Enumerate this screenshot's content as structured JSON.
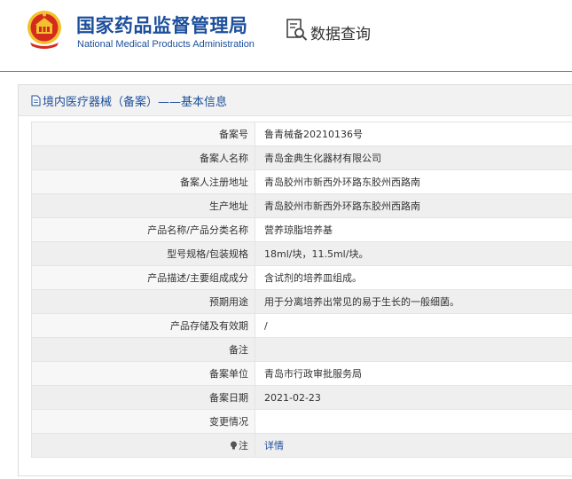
{
  "header": {
    "title_cn": "国家药品监督管理局",
    "title_en": "National Medical Products Administration",
    "query_label": "数据查询",
    "colors": {
      "brand": "#1c4f9c",
      "emblem_red": "#d52b1e",
      "emblem_gold": "#f2c12e"
    }
  },
  "panel": {
    "title": "境内医疗器械（备案）——基本信息"
  },
  "rows": [
    {
      "label": "备案号",
      "value": "鲁青械备20210136号"
    },
    {
      "label": "备案人名称",
      "value": "青岛金典生化器材有限公司"
    },
    {
      "label": "备案人注册地址",
      "value": "青岛胶州市新西外环路东胶州西路南"
    },
    {
      "label": "生产地址",
      "value": "青岛胶州市新西外环路东胶州西路南"
    },
    {
      "label": "产品名称/产品分类名称",
      "value": "营养琼脂培养基"
    },
    {
      "label": "型号规格/包装规格",
      "value": "18ml/块，11.5ml/块。"
    },
    {
      "label": "产品描述/主要组成成分",
      "value": "含试剂的培养皿组成。"
    },
    {
      "label": "预期用途",
      "value": "用于分离培养出常见的易于生长的一般细菌。"
    },
    {
      "label": "产品存储及有效期",
      "value": "/"
    },
    {
      "label": "备注",
      "value": ""
    },
    {
      "label": "备案单位",
      "value": "青岛市行政审批服务局"
    },
    {
      "label": "备案日期",
      "value": "2021-02-23"
    },
    {
      "label": "变更情况",
      "value": ""
    },
    {
      "label": "注",
      "value": "详情",
      "icon": "bulb-icon"
    }
  ]
}
